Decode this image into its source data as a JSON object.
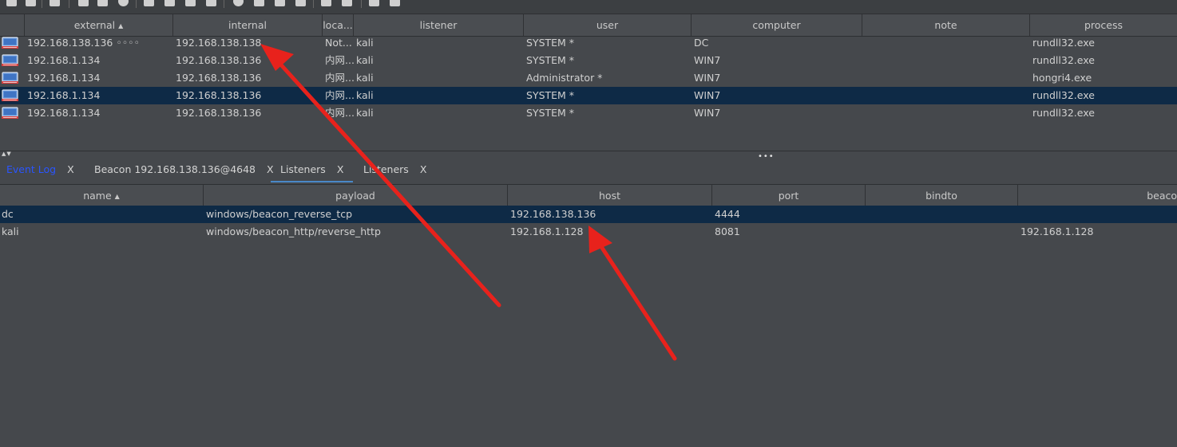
{
  "toolbar": {
    "icons": [
      "disconnect-icon",
      "new-connection-icon",
      "headphones-icon",
      "graph-icon",
      "list-icon",
      "target-icon",
      "screen-icon",
      "download-icon",
      "key-icon",
      "image-icon",
      "gear-icon",
      "coffee-icon",
      "document-icon",
      "terminal-icon",
      "link-icon",
      "cloud-icon",
      "book-icon",
      "package-icon"
    ]
  },
  "beacons_table": {
    "columns": [
      "external",
      "internal",
      "loca...",
      "listener",
      "user",
      "computer",
      "note",
      "process"
    ],
    "rows": [
      {
        "external": "192.168.138.136 ◦◦◦◦",
        "internal": "192.168.138.138",
        "location": "Not...",
        "listener": "kali",
        "user": "SYSTEM *",
        "computer": "DC",
        "note": "",
        "process": "rundll32.exe",
        "selected": false
      },
      {
        "external": "192.168.1.134",
        "internal": "192.168.138.136",
        "location": "内网...",
        "listener": "kali",
        "user": "SYSTEM *",
        "computer": "WIN7",
        "note": "",
        "process": "rundll32.exe",
        "selected": false
      },
      {
        "external": "192.168.1.134",
        "internal": "192.168.138.136",
        "location": "内网...",
        "listener": "kali",
        "user": "Administrator *",
        "computer": "WIN7",
        "note": "",
        "process": "hongri4.exe",
        "selected": false
      },
      {
        "external": "192.168.1.134",
        "internal": "192.168.138.136",
        "location": "内网...",
        "listener": "kali",
        "user": "SYSTEM *",
        "computer": "WIN7",
        "note": "",
        "process": "rundll32.exe",
        "selected": true
      },
      {
        "external": "192.168.1.134",
        "internal": "192.168.138.136",
        "location": "内网...",
        "listener": "kali",
        "user": "SYSTEM *",
        "computer": "WIN7",
        "note": "",
        "process": "rundll32.exe",
        "selected": false
      }
    ]
  },
  "split": {
    "arrows": "▲▼",
    "grip": "•••"
  },
  "tabs": [
    {
      "label": "Event Log",
      "close": "X"
    },
    {
      "label": "Beacon 192.168.138.136@4648",
      "close": "X"
    },
    {
      "label": "Listeners",
      "close": "X"
    },
    {
      "label": "Listeners",
      "close": "X"
    }
  ],
  "listeners_table": {
    "columns": [
      "name",
      "payload",
      "host",
      "port",
      "bindto",
      "beaco"
    ],
    "rows": [
      {
        "name": "dc",
        "payload": "windows/beacon_reverse_tcp",
        "host": "192.168.138.136",
        "port": "4444",
        "bindto": "",
        "beacons": "",
        "selected": true
      },
      {
        "name": "kali",
        "payload": "windows/beacon_http/reverse_http",
        "host": "192.168.1.128",
        "port": "8081",
        "bindto": "",
        "beacons": "192.168.1.128",
        "selected": false
      }
    ]
  },
  "colors": {
    "background": "#45484c",
    "selected_row": "#0e2a46",
    "arrow": "#e8221c",
    "active_tab_underline": "#4a88c7",
    "event_log_text": "#2a55ff"
  }
}
